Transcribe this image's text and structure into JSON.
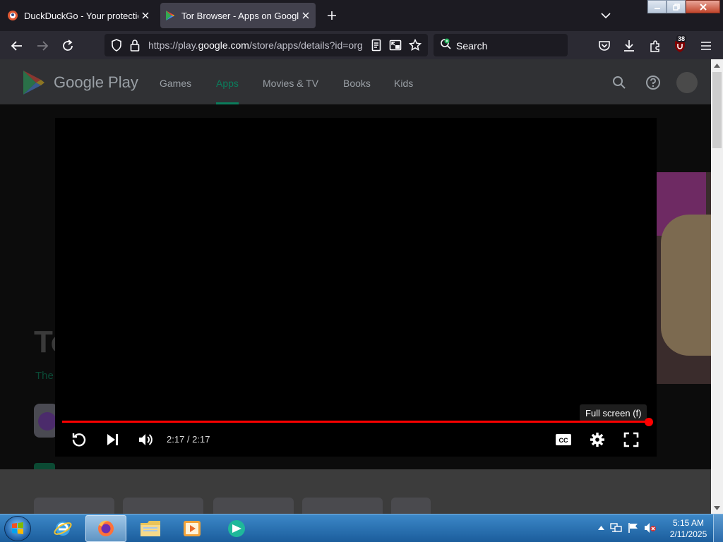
{
  "browser": {
    "tabs": [
      {
        "title": "DuckDuckGo - Your protection",
        "active": false,
        "favicon": "duckduckgo-icon"
      },
      {
        "title": "Tor Browser - Apps on Google P",
        "active": true,
        "favicon": "google-play-icon"
      }
    ],
    "url": {
      "prefix": "https://play.",
      "domain": "google.com",
      "path": "/store/apps/details?id=org"
    },
    "search_placeholder": "Search",
    "extension_badge": "38"
  },
  "google_play": {
    "logo_text": "Google Play",
    "nav": [
      "Games",
      "Apps",
      "Movies & TV",
      "Books",
      "Kids"
    ],
    "active_nav": "Apps",
    "ghost_title": "To",
    "ghost_subtitle": "The"
  },
  "player": {
    "tooltip": "Full screen (f)",
    "time": "2:17 / 2:17",
    "progress": 1.0,
    "accent_color": "#ff0000"
  },
  "taskbar": {
    "time": "5:15 AM",
    "date": "2/11/2025"
  }
}
